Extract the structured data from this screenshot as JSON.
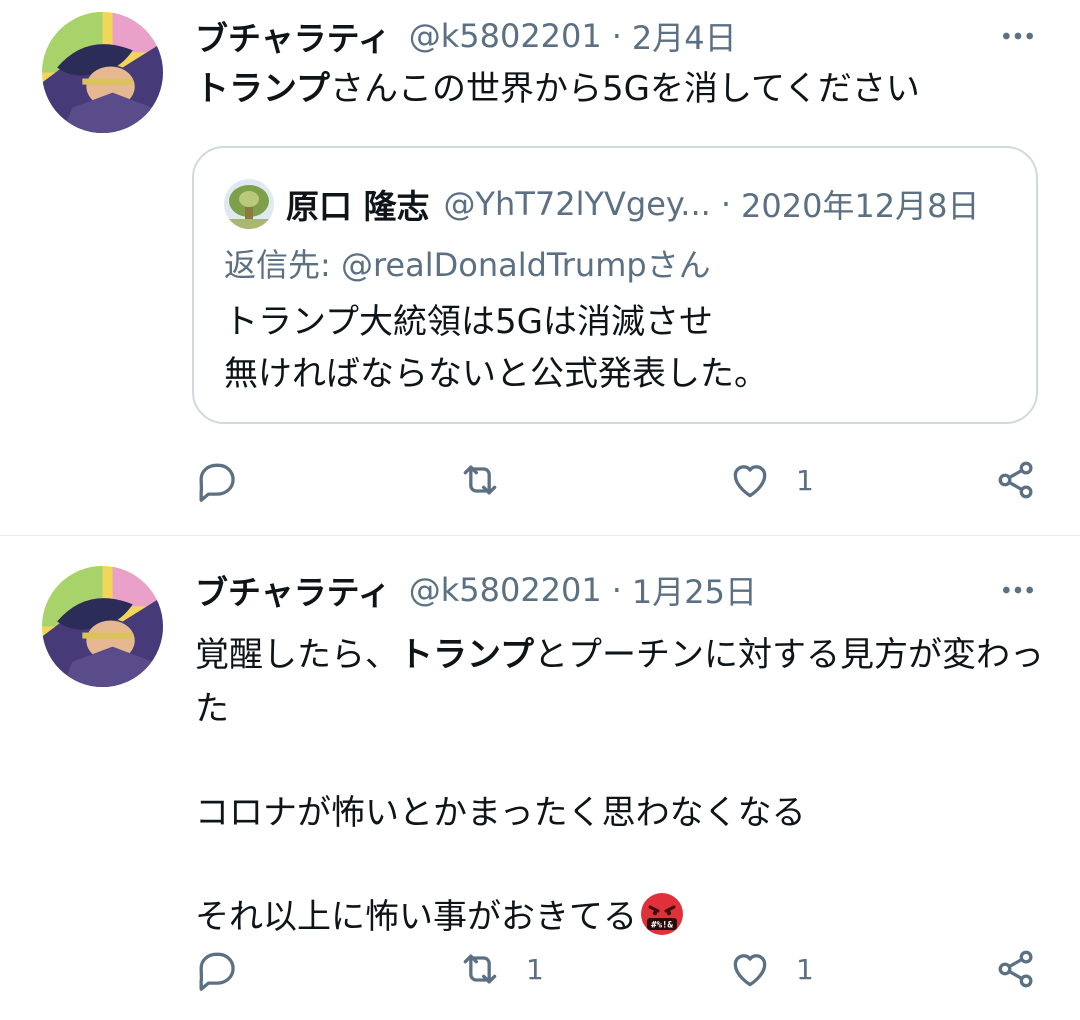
{
  "colors": {
    "text": "#0f1419",
    "secondary": "#5b7083",
    "border": "#cfd9de",
    "emoji_red": "#e0303a"
  },
  "tweets": [
    {
      "name": "ブチャラティ",
      "handle": "@k5802201",
      "separator": "·",
      "date": "2月4日",
      "text_parts": [
        "トランプ",
        "さんこの世界から5Gを消してください"
      ],
      "quote": {
        "name": "原口 隆志",
        "handle": "@YhT72lYVgey...",
        "separator": "·",
        "date": "2020年12月8日",
        "reply_to": "返信先: @realDonaldTrumpさん",
        "lines": [
          "トランプ大統領は5Gは消滅させ",
          "無ければならないと公式発表した。"
        ]
      },
      "actions": {
        "reply_count": "",
        "retweet_count": "",
        "like_count": "1"
      }
    },
    {
      "name": "ブチャラティ",
      "handle": "@k5802201",
      "separator": "·",
      "date": "1月25日",
      "text_parts": [
        "覚醒したら、",
        "トランプ",
        "とプーチンに対する見方が変わった"
      ],
      "paragraph_2": "コロナが怖いとかまったく思わなくなる",
      "paragraph_3": "それ以上に怖い事がおきてる",
      "emoji": {
        "name": "cursing-face-emoji",
        "symbols": "#%!&"
      },
      "actions": {
        "reply_count": "",
        "retweet_count": "1",
        "like_count": "1"
      }
    }
  ],
  "icons": {
    "more": "more-horizontal-icon",
    "reply": "reply-bubble-icon",
    "retweet": "retweet-icon",
    "like": "heart-icon",
    "share": "share-icon"
  }
}
